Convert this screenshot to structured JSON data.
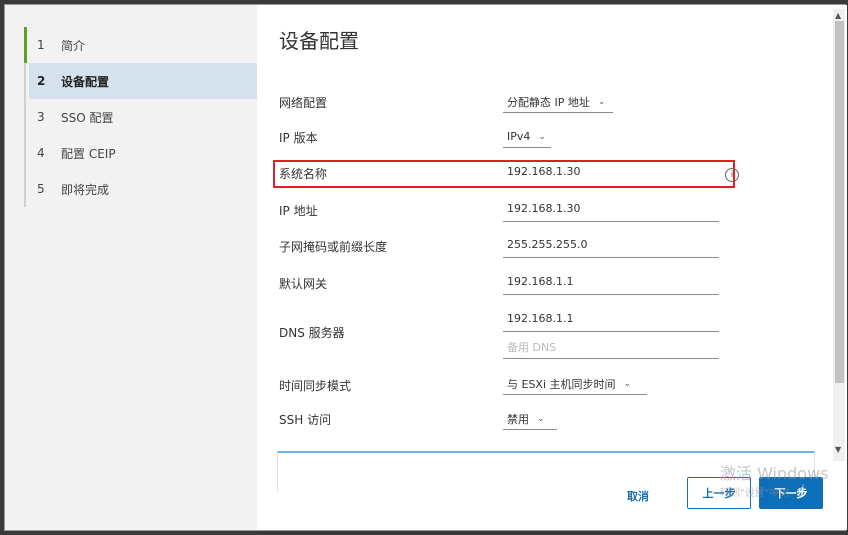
{
  "steps": [
    {
      "num": "1",
      "label": "简介"
    },
    {
      "num": "2",
      "label": "设备配置"
    },
    {
      "num": "3",
      "label": "SSO 配置"
    },
    {
      "num": "4",
      "label": "配置 CEIP"
    },
    {
      "num": "5",
      "label": "即将完成"
    }
  ],
  "title": "设备配置",
  "fields": {
    "network_config": {
      "label": "网络配置",
      "value": "分配静态 IP 地址"
    },
    "ip_version": {
      "label": "IP 版本",
      "value": "IPv4"
    },
    "system_name": {
      "label": "系统名称",
      "value": "192.168.1.30"
    },
    "ip_address": {
      "label": "IP 地址",
      "value": "192.168.1.30"
    },
    "subnet": {
      "label": "子网掩码或前缀长度",
      "value": "255.255.255.0"
    },
    "gateway": {
      "label": "默认网关",
      "value": "192.168.1.1"
    },
    "dns": {
      "label": "DNS 服务器",
      "value": "192.168.1.1",
      "placeholder": "备用 DNS"
    },
    "time_sync": {
      "label": "时间同步模式",
      "value": "与 ESXi 主机同步时间"
    },
    "ssh": {
      "label": "SSH 访问",
      "value": "禁用"
    }
  },
  "buttons": {
    "cancel": "取消",
    "back": "上一步",
    "next": "下一步"
  },
  "watermark": {
    "line1": "激活 Windows",
    "line2": "转到\"设置\"中的"
  },
  "colors": {
    "highlight": "#e02020",
    "accent": "#0d6fb8",
    "active_step": "#5aa220"
  }
}
